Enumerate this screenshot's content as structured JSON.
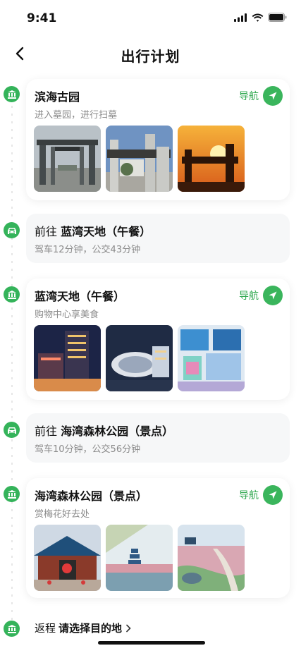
{
  "status_bar": {
    "time": "9:41"
  },
  "header": {
    "title": "出行计划"
  },
  "stops": [
    {
      "title": "滨海古园",
      "subtitle": "进入墓园，进行扫墓",
      "nav_label": "导航",
      "photos": [
        "memorial-gate-photo",
        "memorial-gate-closeup-photo",
        "memorial-gate-sunset-photo"
      ]
    },
    {
      "title": "蓝湾天地（午餐）",
      "subtitle": "购物中心享美食",
      "nav_label": "导航",
      "photos": [
        "mall-night-photo",
        "mall-aerial-photo",
        "mall-interior-photo"
      ]
    },
    {
      "title": "海湾森林公园（景点）",
      "subtitle": "赏梅花好去处",
      "nav_label": "导航",
      "photos": [
        "park-entrance-photo",
        "park-pagoda-lake-photo",
        "park-plum-blossom-photo"
      ]
    }
  ],
  "routes": [
    {
      "prefix": "前往",
      "destination": "蓝湾天地（午餐）",
      "detail": "驾车12分钟，公交43分钟"
    },
    {
      "prefix": "前往",
      "destination": "海湾森林公园（景点）",
      "detail": "驾车10分钟，公交56分钟"
    }
  ],
  "return_trip": {
    "label": "返程",
    "action": "请选择目的地"
  },
  "icons": {
    "stop": "landmark-icon",
    "route": "car-icon",
    "navigate": "navigation-arrow-icon",
    "back": "chevron-left-icon"
  },
  "colors": {
    "accent": "#34b35a",
    "nav_text": "#2fa84f",
    "subtitle": "#8a8a8a",
    "route_bg": "#f6f7f8"
  }
}
